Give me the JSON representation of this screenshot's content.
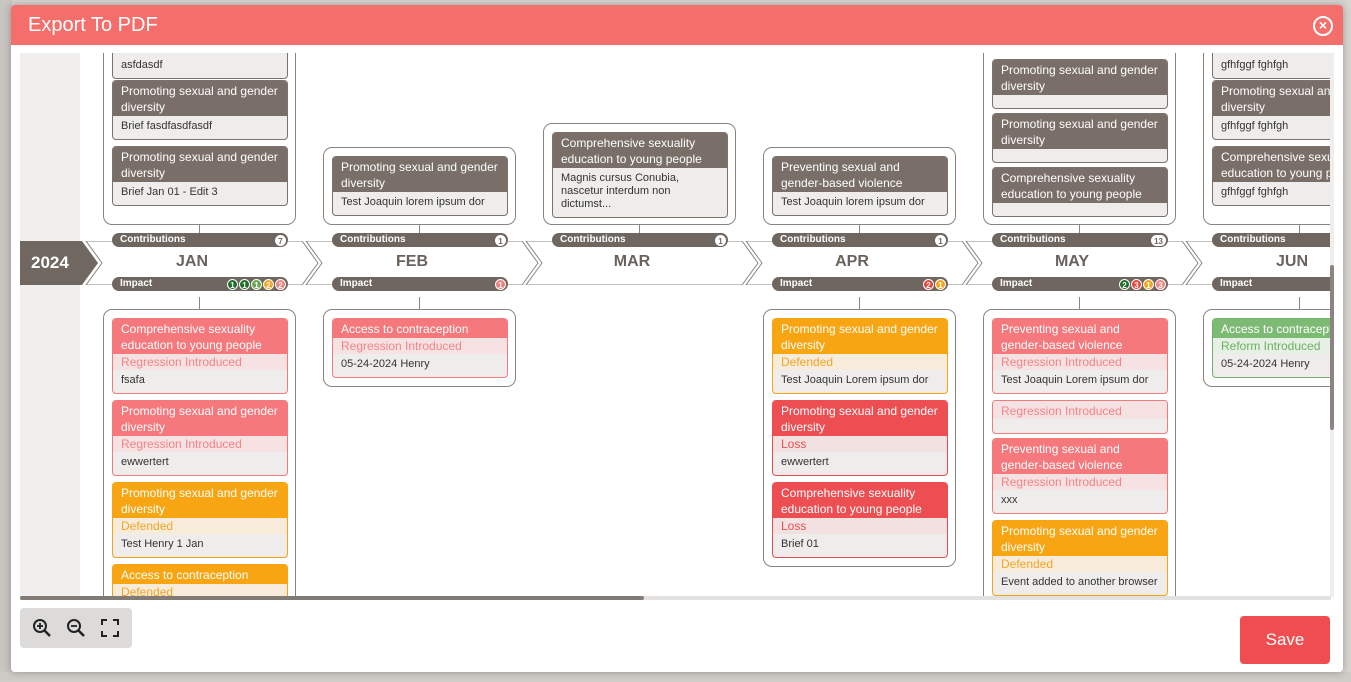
{
  "modal": {
    "title": "Export To PDF"
  },
  "year": "2024",
  "labels": {
    "contributions": "Contributions",
    "impact": "Impact"
  },
  "colors": {
    "header": "#f46e6c",
    "save": "#ef4d50",
    "badge_green": "#1f6d2a",
    "badge_lightgreen": "#6aa84f",
    "badge_orange": "#f5a623",
    "badge_pink": "#f2807f",
    "badge_red": "#e9443c"
  },
  "months": [
    {
      "name": "JAN",
      "contributions": "7",
      "impact_badges": [
        {
          "v": "1",
          "c": "#1f6d2a"
        },
        {
          "v": "1",
          "c": "#1f6d2a"
        },
        {
          "v": "1",
          "c": "#6aa84f"
        },
        {
          "v": "2",
          "c": "#f5a623"
        },
        {
          "v": "2",
          "c": "#f2807f"
        }
      ]
    },
    {
      "name": "FEB",
      "contributions": "1",
      "impact_badges": [
        {
          "v": "1",
          "c": "#f2807f"
        }
      ]
    },
    {
      "name": "MAR",
      "contributions": "1",
      "impact_badges": []
    },
    {
      "name": "APR",
      "contributions": "1",
      "impact_badges": [
        {
          "v": "2",
          "c": "#e9443c"
        },
        {
          "v": "1",
          "c": "#f5a623"
        }
      ]
    },
    {
      "name": "MAY",
      "contributions": "13",
      "impact_badges": [
        {
          "v": "2",
          "c": "#1f6d2a"
        },
        {
          "v": "3",
          "c": "#e9443c"
        },
        {
          "v": "1",
          "c": "#f5a623"
        },
        {
          "v": "3",
          "c": "#f2807f"
        }
      ]
    },
    {
      "name": "JUN",
      "contributions": "",
      "impact_badges": []
    }
  ],
  "top": {
    "jan": [
      {
        "body": "asfdasdf"
      },
      {
        "title": "Promoting sexual and gender diversity",
        "body": "Brief fasdfasdfasdf"
      },
      {
        "title": "Promoting sexual and gender diversity",
        "body": "Brief Jan 01 - Edit 3"
      }
    ],
    "feb": [
      {
        "title": "Promoting sexual and gender diversity",
        "body": "Test Joaquin lorem ipsum dor"
      }
    ],
    "mar": [
      {
        "title": "Comprehensive sexuality education to young people",
        "body": "Magnis cursus Conubia, nascetur interdum non dictumst..."
      }
    ],
    "apr": [
      {
        "title": "Preventing sexual and gender-based violence",
        "body": "Test Joaquin lorem ipsum dor"
      }
    ],
    "may": [
      {
        "title": "Promoting sexual and gender diversity",
        "body": ""
      },
      {
        "title": "Promoting sexual and gender diversity",
        "body": ""
      },
      {
        "title": "Comprehensive sexuality education to young people",
        "body": ""
      }
    ],
    "jun": [
      {
        "body": "gfhfggf fghfgh"
      },
      {
        "title": "Promoting sexual and gender diversity",
        "body": "gfhfggf fghfgh"
      },
      {
        "title": "Comprehensive sexuality education to young people",
        "body": "gfhfggf fghfgh"
      }
    ]
  },
  "impact": {
    "jan": [
      {
        "title": "Comprehensive sexuality education to young people",
        "status": "Regression Introduced",
        "body": "fsafa"
      },
      {
        "title": "Promoting sexual and gender diversity",
        "status": "Regression Introduced",
        "body": "ewwertert"
      },
      {
        "title": "Promoting sexual and gender diversity",
        "status": "Defended",
        "body": "Test Henry 1 Jan"
      },
      {
        "title": "Access to contraception",
        "status": "Defended",
        "body": ""
      }
    ],
    "feb": [
      {
        "title": "Access to contraception",
        "status": "Regression Introduced",
        "body": "05-24-2024 Henry"
      }
    ],
    "apr": [
      {
        "title": "Promoting sexual and gender diversity",
        "status": "Defended",
        "body": "Test Joaquin Lorem ipsum dor"
      },
      {
        "title": "Promoting sexual and gender diversity",
        "status": "Loss",
        "body": "ewwertert"
      },
      {
        "title": "Comprehensive sexuality education to young people",
        "status": "Loss",
        "body": "Brief 01"
      }
    ],
    "may": [
      {
        "title": "Preventing sexual and gender-based violence",
        "status": "Regression Introduced",
        "body": "Test Joaquin Lorem ipsum dor"
      },
      {
        "title": "",
        "status": "Regression Introduced",
        "body": ""
      },
      {
        "title": "Preventing sexual and gender-based violence",
        "status": "Regression Introduced",
        "body": "xxx"
      },
      {
        "title": "Promoting sexual and gender diversity",
        "status": "Defended",
        "body": "Event added to another browser"
      }
    ],
    "jun": [
      {
        "title": "Access to contraception",
        "status": "Reform Introduced",
        "body": "05-24-2024 Henry"
      }
    ]
  },
  "zoom": {
    "in": "zoom-in",
    "out": "zoom-out",
    "fit": "fullscreen"
  },
  "save_label": "Save"
}
